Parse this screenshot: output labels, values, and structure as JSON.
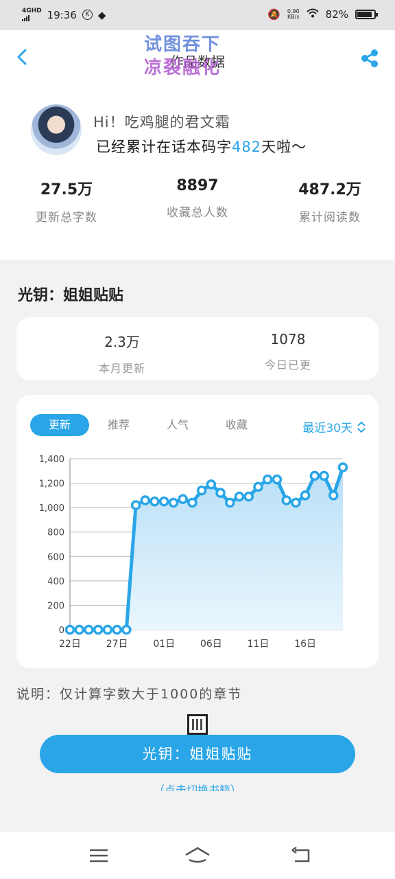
{
  "status_bar": {
    "network": "4GHD",
    "time": "19:36",
    "speed_value": "0.90",
    "speed_unit": "KB/s",
    "battery": "82%",
    "battery_level": 0.82
  },
  "header": {
    "title": "作品数据",
    "watermark_line1": "试图吞下",
    "watermark_line2": "凉裂融化"
  },
  "profile": {
    "greeting": "Hi！吃鸡腿的君文霜",
    "days_prefix": "已经累计在话本码字",
    "days_value": "482",
    "days_suffix": "天啦～",
    "stats": [
      {
        "value": "27.5万",
        "label": "更新总字数"
      },
      {
        "value": "8897",
        "label": "收藏总人数"
      },
      {
        "value": "487.2万",
        "label": "累计阅读数"
      }
    ]
  },
  "book": {
    "title": "光钥：姐姐贴贴"
  },
  "month_summary": {
    "items": [
      {
        "value": "2.3万",
        "label": "本月更新"
      },
      {
        "value": "1078",
        "label": "今日已更"
      }
    ]
  },
  "chart_card": {
    "tabs": [
      "更新",
      "推荐",
      "人气",
      "收藏"
    ],
    "active_tab": "更新",
    "range_label": "最近30天"
  },
  "chart_data": {
    "type": "area",
    "x": [
      22,
      23,
      24,
      25,
      26,
      27,
      28,
      29,
      30,
      31,
      1,
      2,
      3,
      4,
      5,
      6,
      7,
      8,
      9,
      10,
      11,
      12,
      13,
      14,
      15,
      16,
      17,
      18,
      19,
      20,
      21
    ],
    "x_tick_labels": [
      "22日",
      "27日",
      "01日",
      "06日",
      "11日",
      "16日"
    ],
    "values": [
      0,
      0,
      0,
      0,
      0,
      0,
      0,
      1020,
      1060,
      1050,
      1050,
      1040,
      1070,
      1040,
      1140,
      1190,
      1120,
      1040,
      1090,
      1090,
      1170,
      1230,
      1230,
      1060,
      1040,
      1100,
      1260,
      1260,
      1100,
      1330
    ],
    "yticks": [
      "0",
      "200",
      "400",
      "600",
      "800",
      "1,000",
      "1,200",
      "1,400"
    ],
    "ylim": [
      0,
      1400
    ],
    "grid": true,
    "color": "#2aa6e8"
  },
  "note": "说明：仅计算字数大于1000的章节",
  "switch_button": {
    "label": "光钥：姐姐贴贴",
    "hint": "（点击切换书籍）"
  }
}
